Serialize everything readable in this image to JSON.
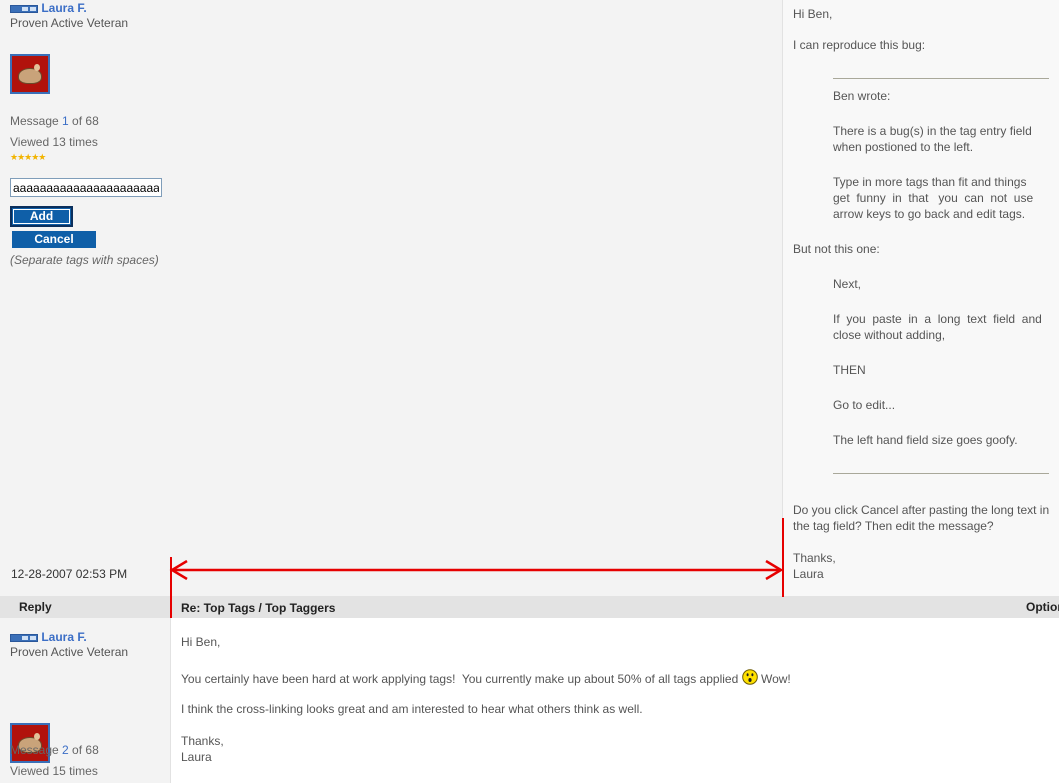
{
  "post1": {
    "author": "Laura F.",
    "rank_title": "Proven Active Veteran",
    "message_prefix": "Message ",
    "message_num": "1",
    "message_suffix": " of 68",
    "viewed": "Viewed 13 times",
    "stars": "★★★★★",
    "tag_input_value": "aaaaaaaaaaaaaaaaaaaaaaaaaaa",
    "add_label": "Add",
    "cancel_label": "Cancel",
    "tag_hint": "(Separate tags with spaces)",
    "date": "12-28-2007 02:53 PM",
    "body": {
      "greeting": "Hi Ben,",
      "intro": "I can reproduce this bug:",
      "quote_header": "Ben wrote:",
      "q1a": "There is a bug(s) in the tag entry field",
      "q1b": "when postioned to the left.",
      "q2a": "Type in more tags than fit and things",
      "q2b": "get  funny  in  that   you  can  not  use",
      "q2c": "arrow keys to go back and edit tags.",
      "but": "But not this one:",
      "q3": "Next,",
      "q4a": "If  you  paste  in  a  long  text  field  and",
      "q4b": "close without adding,",
      "q5": "THEN",
      "q6": "Go to edit...",
      "q7": "The left hand field size goes goofy.",
      "ask1": "Do you click Cancel after pasting the long text in",
      "ask2": "the tag field? Then edit the message?",
      "thanks": "Thanks,",
      "sign": "Laura"
    }
  },
  "reply_bar": {
    "reply_label": "Reply",
    "subject": "Re: Top Tags / Top Taggers",
    "options": "Options"
  },
  "post2": {
    "author": "Laura F.",
    "rank_title": "Proven Active Veteran",
    "message_prefix": "Message ",
    "message_num": "2",
    "message_suffix": " of 68",
    "viewed": "Viewed 15 times",
    "body": {
      "greeting": "Hi Ben,",
      "line1a": "You certainly have been hard at work applying tags!  You currently make up about 50% of all tags applied",
      "line1b": "Wow!",
      "line2": "I think the cross-linking looks great and am interested to hear what others think as well.",
      "thanks": "Thanks,",
      "sign": "Laura"
    }
  },
  "colors": {
    "link": "#3b6ec6",
    "button": "#0f5fa8",
    "annotation": "#e60000"
  }
}
